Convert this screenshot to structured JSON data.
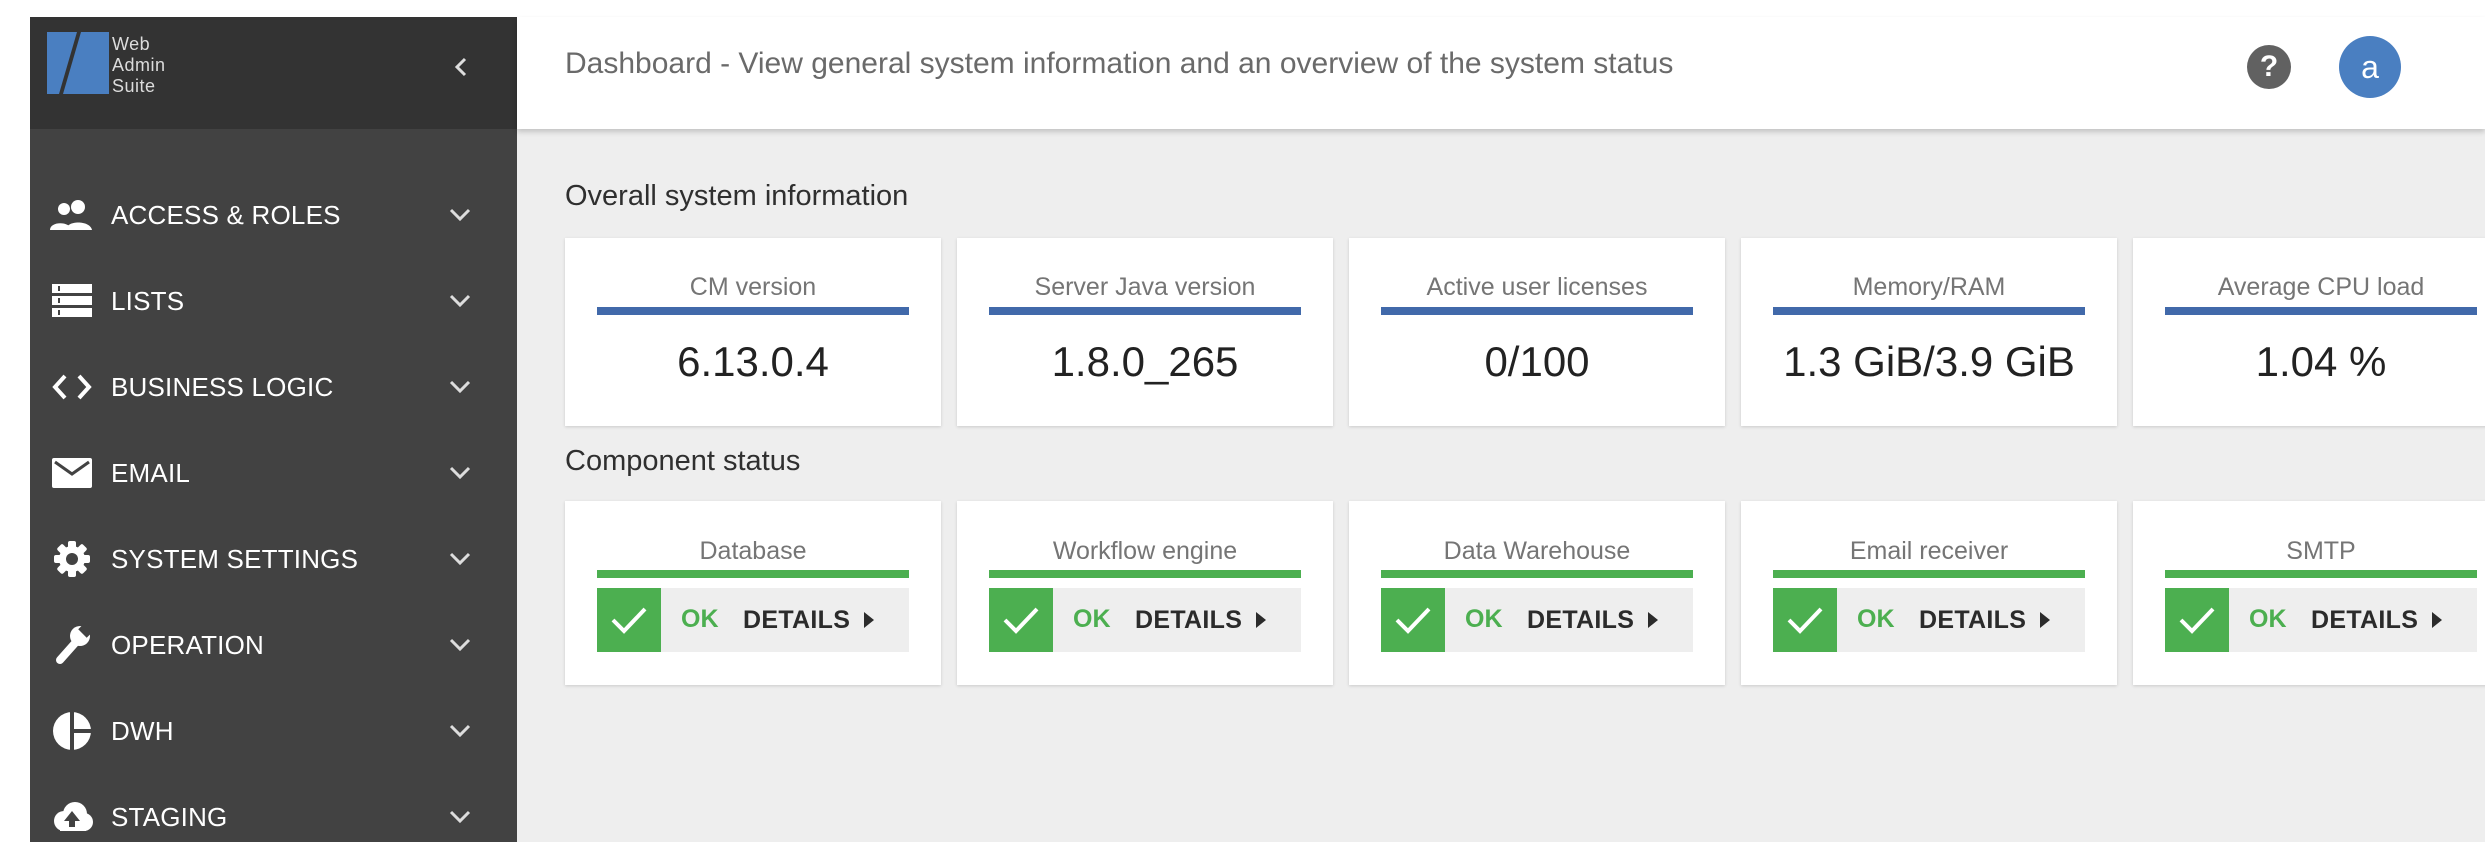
{
  "brand": {
    "line1": "Web",
    "line2": "Admin",
    "line3": "Suite"
  },
  "sidebar": {
    "items": [
      {
        "label": "ACCESS & ROLES",
        "icon": "people-icon"
      },
      {
        "label": "LISTS",
        "icon": "list-icon"
      },
      {
        "label": "BUSINESS LOGIC",
        "icon": "code-icon"
      },
      {
        "label": "EMAIL",
        "icon": "envelope-icon"
      },
      {
        "label": "SYSTEM SETTINGS",
        "icon": "gear-icon"
      },
      {
        "label": "OPERATION",
        "icon": "wrench-icon"
      },
      {
        "label": "DWH",
        "icon": "pie-chart-icon"
      },
      {
        "label": "STAGING",
        "icon": "cloud-upload-icon"
      }
    ]
  },
  "header": {
    "title": "Dashboard - View general system information and an overview of the system status",
    "help_label": "?",
    "avatar_letter": "a"
  },
  "overall": {
    "title": "Overall system information",
    "cards": [
      {
        "title": "CM version",
        "value": "6.13.0.4"
      },
      {
        "title": "Server Java version",
        "value": "1.8.0_265"
      },
      {
        "title": "Active user licenses",
        "value": "0/100"
      },
      {
        "title": "Memory/RAM",
        "value": "1.3 GiB/3.9 GiB"
      },
      {
        "title": "Average CPU load",
        "value": "1.04 %"
      }
    ]
  },
  "components": {
    "title": "Component status",
    "cards": [
      {
        "title": "Database",
        "status": "OK",
        "details": "DETAILS"
      },
      {
        "title": "Workflow engine",
        "status": "OK",
        "details": "DETAILS"
      },
      {
        "title": "Data Warehouse",
        "status": "OK",
        "details": "DETAILS"
      },
      {
        "title": "Email receiver",
        "status": "OK",
        "details": "DETAILS"
      },
      {
        "title": "SMTP",
        "status": "OK",
        "details": "DETAILS"
      }
    ]
  },
  "colors": {
    "sidebar_bg": "#424242",
    "brand_bg": "#333333",
    "info_accent": "#4169aa",
    "status_ok": "#4caf50",
    "avatar": "#4a7fc1"
  }
}
